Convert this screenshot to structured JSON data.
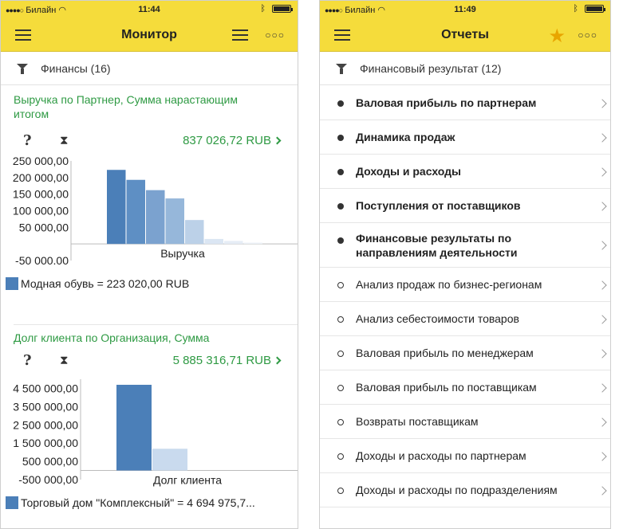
{
  "left": {
    "status": {
      "carrier": "Билайн",
      "time": "11:44"
    },
    "title": "Монитор",
    "filter": "Финансы (16)",
    "widget1": {
      "title": "Выручка по Партнер, Сумма нарастающим итогом",
      "help": "?",
      "hourglass": "⧗",
      "total": "837 026,72 RUB",
      "legend": "Модная обувь = 223 020,00 RUB"
    },
    "widget2": {
      "title": "Долг клиента по Организация, Сумма",
      "help": "?",
      "hourglass": "⧗",
      "total": "5 885 316,71 RUB",
      "legend": "Торговый дом \"Комплексный\" = 4 694 975,7..."
    }
  },
  "right": {
    "status": {
      "carrier": "Билайн",
      "time": "11:49"
    },
    "title": "Отчеты",
    "filter": "Финансовый результат (12)",
    "items": [
      {
        "label": "Валовая прибыль по партнерам",
        "bold": true
      },
      {
        "label": "Динамика продаж",
        "bold": true
      },
      {
        "label": "Доходы и расходы",
        "bold": true
      },
      {
        "label": "Поступления от поставщиков",
        "bold": true
      },
      {
        "label": "Финансовые результаты по направлениям деятельности",
        "bold": true
      },
      {
        "label": "Анализ продаж по бизнес-регионам",
        "bold": false
      },
      {
        "label": "Анализ себестоимости товаров",
        "bold": false
      },
      {
        "label": "Валовая прибыль по менеджерам",
        "bold": false
      },
      {
        "label": "Валовая прибыль по поставщикам",
        "bold": false
      },
      {
        "label": "Возвраты поставщикам",
        "bold": false
      },
      {
        "label": "Доходы и расходы по партнерам",
        "bold": false
      },
      {
        "label": "Доходы и расходы по подразделениям",
        "bold": false
      }
    ]
  },
  "colors": {
    "header": "#f5dc3b",
    "accent_green": "#2e9a43",
    "bar_blue": "#4b7fb8"
  },
  "chart_data": [
    {
      "type": "bar",
      "categories": [
        "Выручка"
      ],
      "xlabel": "Выручка",
      "ylim": [
        -50000,
        250000
      ],
      "yticks": [
        "250 000,00",
        "200 000,00",
        "150 000,00",
        "100 000,00",
        "50 000,00",
        "-50 000,00"
      ],
      "ytick_values": [
        250000,
        200000,
        150000,
        100000,
        50000,
        -50000
      ],
      "series": [
        {
          "values": [
            223020
          ],
          "color": "#4b7fb8"
        },
        {
          "values": [
            193000
          ],
          "color": "#5e8fc4"
        },
        {
          "values": [
            162000
          ],
          "color": "#7ba2cf"
        },
        {
          "values": [
            137000
          ],
          "color": "#96b7da"
        },
        {
          "values": [
            72000
          ],
          "color": "#bcd1e8"
        },
        {
          "values": [
            15000
          ],
          "color": "#dbe6f3"
        },
        {
          "values": [
            9000
          ],
          "color": "#e6edf6"
        },
        {
          "values": [
            4000
          ],
          "color": "#eef3f9"
        }
      ]
    },
    {
      "type": "bar",
      "categories": [
        "Долг клиента"
      ],
      "xlabel": "Долг клиента",
      "ylim": [
        -500000,
        5000000
      ],
      "yticks": [
        "4 500 000,00",
        "3 500 000,00",
        "2 500 000,00",
        "1 500 000,00",
        "500 000,00",
        "-500 000,00"
      ],
      "ytick_values": [
        4500000,
        3500000,
        2500000,
        1500000,
        500000,
        -500000
      ],
      "series": [
        {
          "values": [
            4694975.7
          ],
          "color": "#4b7fb8"
        },
        {
          "values": [
            1190341
          ],
          "color": "#c9daee"
        }
      ]
    }
  ]
}
